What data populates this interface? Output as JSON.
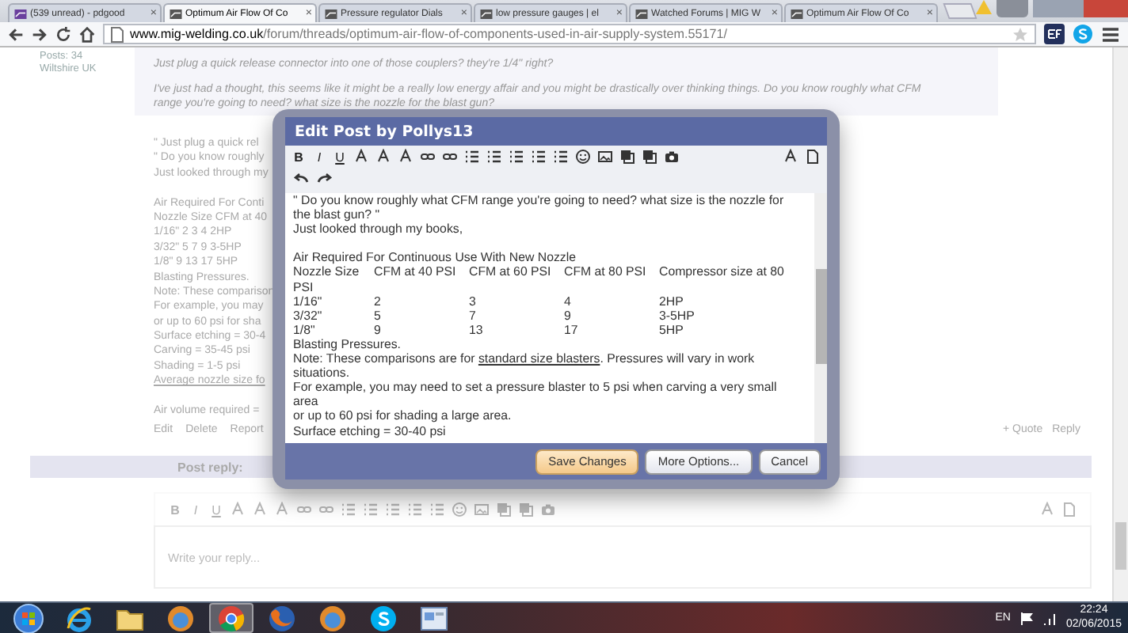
{
  "browser": {
    "tabs": [
      {
        "title": "(539 unread) - pdgood",
        "selected": false,
        "close": "×"
      },
      {
        "title": "Optimum Air Flow Of Co",
        "selected": true,
        "close": "×"
      },
      {
        "title": "Pressure regulator Dials",
        "selected": false,
        "close": "×"
      },
      {
        "title": "low pressure gauges | el",
        "selected": false,
        "close": "×"
      },
      {
        "title": "Watched Forums | MIG W",
        "selected": false,
        "close": "×"
      },
      {
        "title": "Optimum Air Flow Of Co",
        "selected": false,
        "close": "×"
      }
    ],
    "address": {
      "domain": "www.mig-welding.co.uk",
      "path": "/forum/threads/optimum-air-flow-of-components-used-in-air-supply-system.55171/"
    }
  },
  "forum": {
    "user": {
      "posts": "Posts: 34",
      "location": "Wiltshire UK"
    },
    "quote_lines": [
      "Just plug a quick release connector into one of those couplers? they're 1/4\" right?",
      "I've just had a thought, this seems like it might be a really low energy affair and you might be drastically over thinking things. Do you know roughly what CFM",
      "range you're going to need? what size is the nozzle for the blast gun?"
    ],
    "post_lines": [
      {
        "kind": "text",
        "text": "\" Just plug a quick rel"
      },
      {
        "kind": "text",
        "text": "\" Do you know roughly"
      },
      {
        "kind": "text",
        "text": "Just looked through my"
      },
      {
        "kind": "blank"
      },
      {
        "kind": "text",
        "text": "Air Required For Conti"
      },
      {
        "kind": "text",
        "text": "Nozzle Size CFM at 40"
      },
      {
        "kind": "text",
        "text": "1/16\" 2 3 4 2HP"
      },
      {
        "kind": "text",
        "text": "3/32\" 5 7 9 3-5HP"
      },
      {
        "kind": "text",
        "text": "1/8\" 9 13 17 5HP"
      },
      {
        "kind": "text",
        "text": "Blasting Pressures."
      },
      {
        "kind": "text",
        "text": "Note: These comparison"
      },
      {
        "kind": "text",
        "text": "For example, you may"
      },
      {
        "kind": "text",
        "text": "or up to 60 psi for sha"
      },
      {
        "kind": "text",
        "text": "Surface etching = 30-4"
      },
      {
        "kind": "text",
        "text": "Carving = 35-45 psi"
      },
      {
        "kind": "text",
        "text": "Shading = 1-5 psi"
      },
      {
        "kind": "link",
        "text": "Average nozzle size fo"
      },
      {
        "kind": "blank"
      },
      {
        "kind": "text",
        "text": "Air volume required ="
      }
    ],
    "actions": [
      "Edit",
      "Delete",
      "Report"
    ],
    "right_actions": [
      "+ Quote",
      "Reply"
    ],
    "reply": {
      "label": "Post reply:",
      "toolbar_letters": [
        "B",
        "I",
        "U"
      ],
      "placeholder": "Write your reply..."
    }
  },
  "dialog": {
    "title": "Edit Post by Pollys13",
    "toolbar_letters": [
      "B",
      "I",
      "U"
    ],
    "lines": [
      {
        "kind": "text",
        "text": "\" Do you know roughly what CFM range you're going to need? what size is the nozzle for"
      },
      {
        "kind": "text",
        "text": "the blast gun? \""
      },
      {
        "kind": "text",
        "text": "Just looked through my books,"
      },
      {
        "kind": "blank"
      },
      {
        "kind": "text",
        "text": "Air Required For Continuous Use With New Nozzle"
      },
      {
        "kind": "row",
        "cells": [
          "Nozzle Size",
          "CFM at 40 PSI",
          "CFM at 60 PSI",
          "CFM at 80 PSI",
          "Compressor size at 80"
        ]
      },
      {
        "kind": "text",
        "text": "PSI"
      },
      {
        "kind": "row",
        "cells": [
          "1/16\"",
          "2",
          "3",
          "4",
          "2HP"
        ]
      },
      {
        "kind": "row",
        "cells": [
          "3/32\"",
          "5",
          "7",
          "9",
          "3-5HP"
        ]
      },
      {
        "kind": "row",
        "cells": [
          "1/8\"",
          "9",
          "13",
          "17",
          "5HP"
        ]
      },
      {
        "kind": "text",
        "text": "Blasting Pressures."
      },
      {
        "kind": "parts",
        "parts": [
          {
            "text": "Note: These comparisons are for ",
            "link": false
          },
          {
            "text": "standard size blasters",
            "link": true
          },
          {
            "text": ". Pressures will vary in work",
            "link": false
          }
        ]
      },
      {
        "kind": "text",
        "text": "situations."
      },
      {
        "kind": "text",
        "text": "For example, you may need to set a pressure blaster to 5 psi when carving a very small"
      },
      {
        "kind": "text",
        "text": "area"
      },
      {
        "kind": "text",
        "text": "or up to 60 psi for shading a large area."
      },
      {
        "kind": "text",
        "text": "Surface etching = 30-40 psi"
      }
    ],
    "buttons": [
      {
        "label": "Save Changes",
        "primary": true
      },
      {
        "label": "More Options...",
        "primary": false
      },
      {
        "label": "Cancel",
        "primary": false
      }
    ]
  },
  "taskbar": {
    "apps": [
      {
        "kind": "start",
        "selected": false
      },
      {
        "kind": "ie",
        "selected": false
      },
      {
        "kind": "folder",
        "selected": false
      },
      {
        "kind": "round",
        "selected": false
      },
      {
        "kind": "chrome",
        "selected": true
      },
      {
        "kind": "firefox",
        "selected": false
      },
      {
        "kind": "round",
        "selected": false
      },
      {
        "kind": "skype",
        "selected": false
      },
      {
        "kind": "window",
        "selected": false
      }
    ],
    "language": "EN",
    "time": "22:24",
    "date": "02/06/2015"
  }
}
